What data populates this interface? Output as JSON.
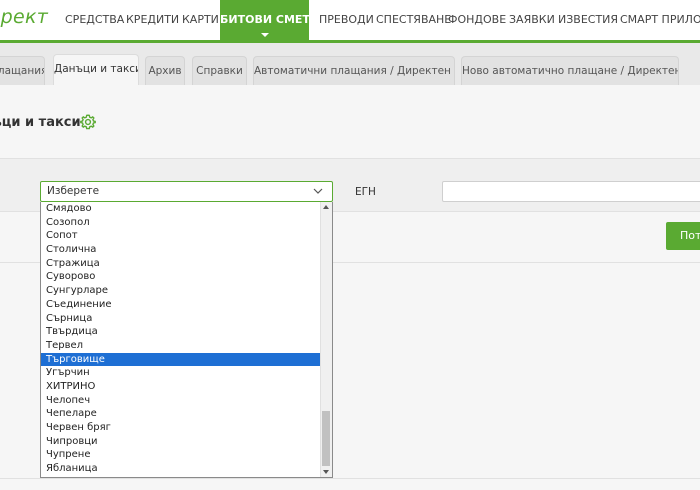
{
  "brand": {
    "logo_text": "ирект",
    "accent": "#5aaa32",
    "selection": "#1e6fd4"
  },
  "top_nav": [
    "СРЕДСТВА",
    "КРЕДИТИ",
    "КАРТИ",
    "БИТОВИ СМЕТКИ",
    "ПРЕВОДИ",
    "СПЕСТЯВАНЕ",
    "ФОНДОВЕ",
    "ЗАЯВКИ",
    "ИЗВЕСТИЯ",
    "СМАРТ ПРИЛОЖЕ"
  ],
  "top_nav_active": "БИТОВИ СМЕТКИ",
  "tabs": [
    "плащания",
    "Данъци и такси",
    "Архив",
    "Справки",
    "Автоматични плащания / Директен дебит",
    "Ново автоматично плащане / Директен дебит"
  ],
  "tabs_active": "Данъци и такси",
  "page": {
    "title": "ъци и такси"
  },
  "form": {
    "select_value": "Изберете",
    "egn_label": "ЕГН",
    "egn_value": "",
    "submit_label": "Пот"
  },
  "dropdown": {
    "options": [
      "Смядово",
      "Созопол",
      "Сопот",
      "Столична",
      "Стражица",
      "Суворово",
      "Сунгурларе",
      "Съединение",
      "Сърница",
      "Твърдица",
      "Тервел",
      "Търговище",
      "Угърчин",
      "ХИТРИНО",
      "Челопеч",
      "Чепеларе",
      "Червен бряг",
      "Чипровци",
      "Чупрене",
      "Ябланица"
    ],
    "selected": "Търговище"
  }
}
